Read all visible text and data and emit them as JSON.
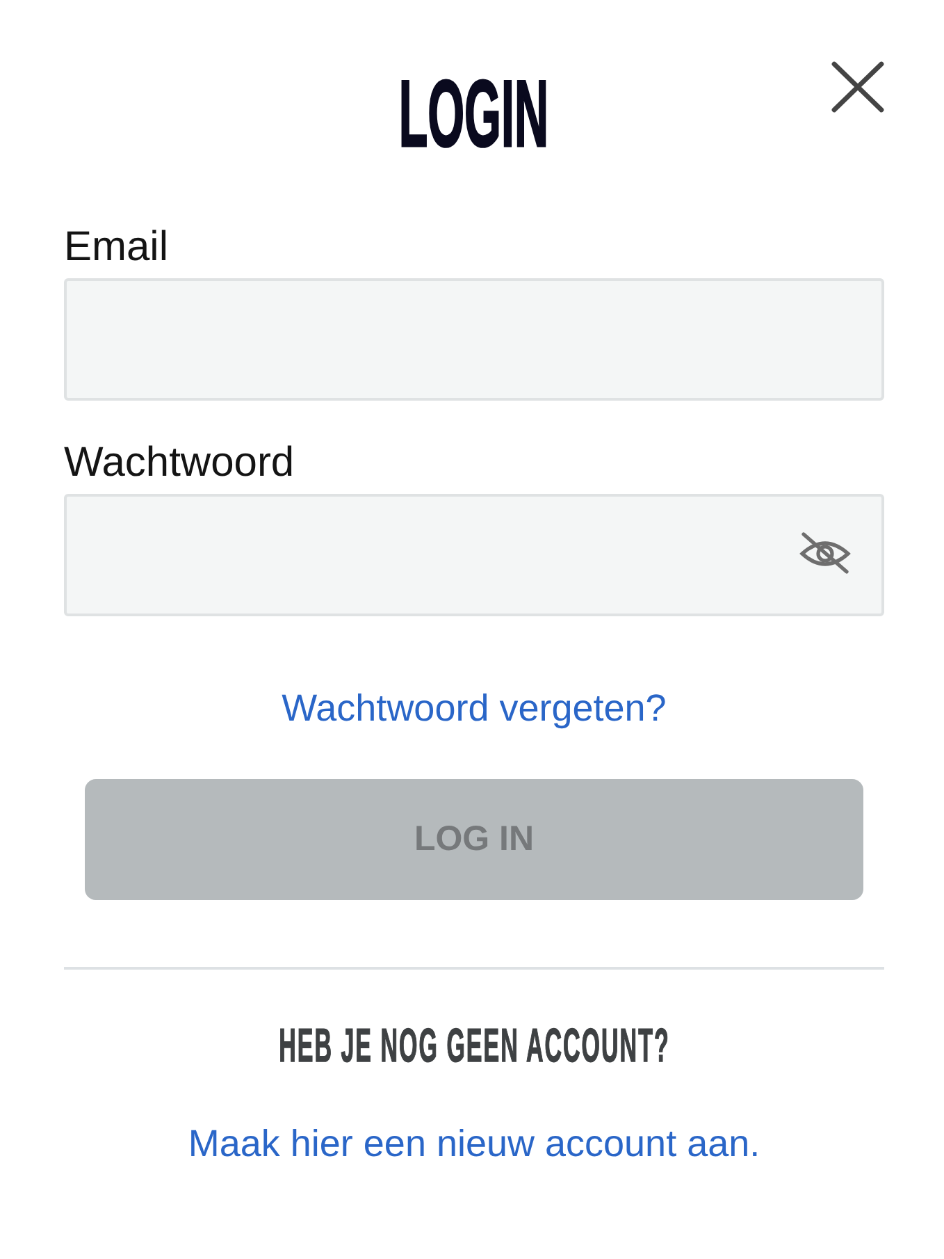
{
  "dialog": {
    "title": "LOGIN"
  },
  "fields": [
    {
      "kind": "email",
      "label": "Email"
    },
    {
      "kind": "password",
      "label": "Wachtwoord",
      "password_visible": false
    }
  ],
  "forgot_link": "Wachtwoord vergeten?",
  "login_button": {
    "label": "LOG IN",
    "disabled": true
  },
  "signup": {
    "heading": "HEB JE NOG GEEN ACCOUNT?",
    "link": "Maak hier een nieuw account aan."
  }
}
